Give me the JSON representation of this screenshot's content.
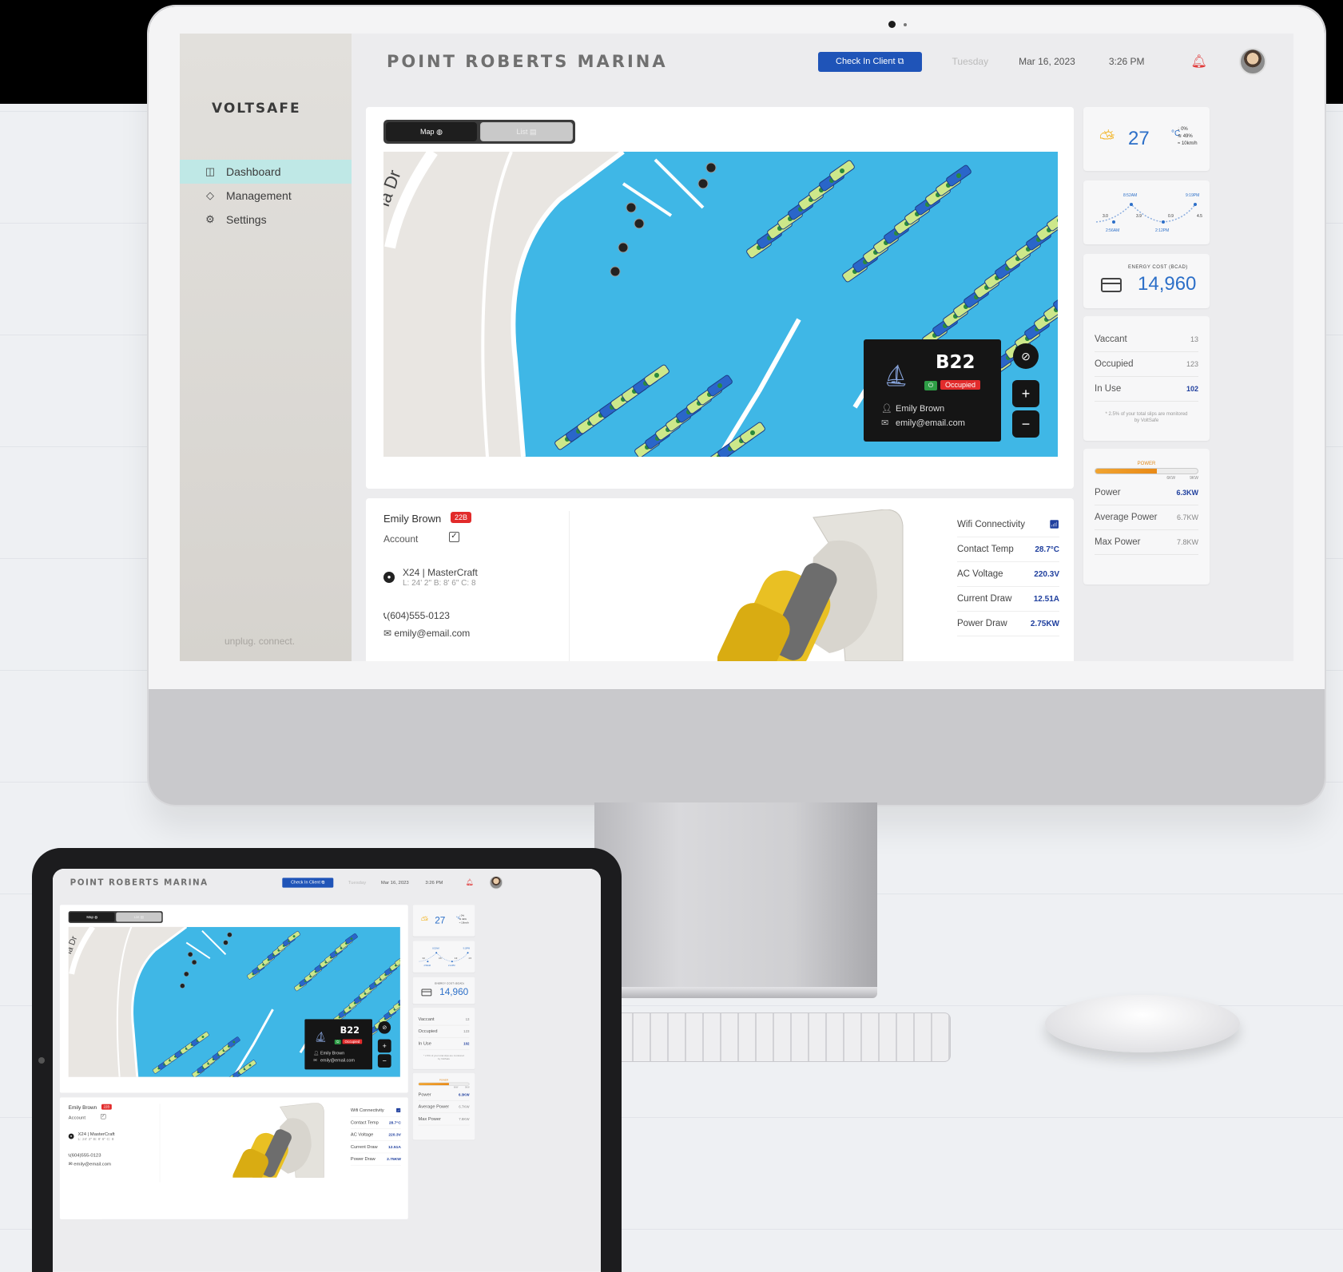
{
  "brand": {
    "logo": "VOLTSAFE",
    "tagline": "unplug. connect."
  },
  "nav": [
    {
      "label": "Dashboard",
      "icon": "dashboard-icon",
      "active": true
    },
    {
      "label": "Management",
      "icon": "diamond-icon",
      "active": false
    },
    {
      "label": "Settings",
      "icon": "gear-icon",
      "active": false
    }
  ],
  "header": {
    "title": "POINT ROBERTS MARINA",
    "checkin_label": "Check In Client",
    "day": "Tuesday",
    "date": "Mar 16, 2023",
    "time": "3:26 PM"
  },
  "map_view": {
    "map_label": "Map",
    "list_label": "List",
    "street_label": "ia Dr",
    "popup": {
      "slip": "B22",
      "status": "Occupied",
      "name": "Emily Brown",
      "email": "emily@email.com"
    },
    "zoom_in": "+",
    "zoom_out": "−"
  },
  "client": {
    "name": "Emily Brown",
    "badge": "22B",
    "account_label": "Account",
    "boat": "X24 | MasterCraft",
    "dims": "L: 24' 2\"  B: 8' 6\"  C: 8",
    "phone": "(604)555-0123",
    "email": "emily@email.com"
  },
  "metrics": [
    {
      "label": "Wifi Connectivity",
      "value": ""
    },
    {
      "label": "Contact Temp",
      "value": "28.7°C"
    },
    {
      "label": "AC Voltage",
      "value": "220.3V"
    },
    {
      "label": "Current Draw",
      "value": "12.51A"
    },
    {
      "label": "Power Draw",
      "value": "2.75KW"
    }
  ],
  "weather": {
    "temp": "27",
    "unit": "°C",
    "precip": "0%",
    "humidity": "49%",
    "wind": "10km/h"
  },
  "tide": {
    "high1_time": "8:52AM",
    "high2_time": "9:19PM",
    "low1_time": "2:56AM",
    "low2_time": "2:12PM",
    "values": [
      "3.0",
      "3.9",
      "0.9",
      "4.5"
    ]
  },
  "energy": {
    "label": "ENERGY COST (BCAD)",
    "value": "14,960"
  },
  "slips": {
    "rows": [
      {
        "label": "Vaccant",
        "value": "13",
        "highlight": false
      },
      {
        "label": "Occupied",
        "value": "123",
        "highlight": false
      },
      {
        "label": "In Use",
        "value": "102",
        "highlight": true
      }
    ],
    "note": "* 2.5% of your total slips are monitored by VoltSafe"
  },
  "power": {
    "label": "POWER",
    "fill_fraction": 0.6,
    "tick1": "6KW",
    "tick2": "9KW",
    "rows": [
      {
        "label": "Power",
        "value": "6.3KW",
        "highlight": true
      },
      {
        "label": "Average Power",
        "value": "6.7KW",
        "highlight": false
      },
      {
        "label": "Max Power",
        "value": "7.8KW",
        "highlight": false
      }
    ]
  },
  "colors": {
    "water": "#3fb7e6",
    "slip_blue": "#2a66c9",
    "slip_green": "#cde88a",
    "accent_blue": "#1f54b8",
    "occupied_red": "#e22b2b"
  }
}
